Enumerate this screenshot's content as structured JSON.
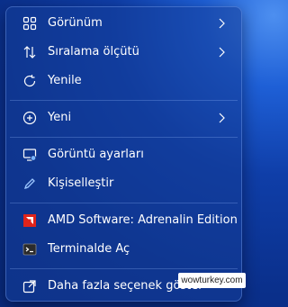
{
  "menu": {
    "items": [
      {
        "label": "Görünüm",
        "icon": "grid-icon",
        "submenu": true
      },
      {
        "label": "Sıralama ölçütü",
        "icon": "sort-arrows-icon",
        "submenu": true
      },
      {
        "label": "Yenile",
        "icon": "refresh-icon",
        "submenu": false
      },
      {
        "label": "Yeni",
        "icon": "plus-circle-icon",
        "submenu": true
      },
      {
        "label": "Görüntü ayarları",
        "icon": "display-settings-icon",
        "submenu": false
      },
      {
        "label": "Kişiselleştir",
        "icon": "pencil-icon",
        "submenu": false
      },
      {
        "label": "AMD Software: Adrenalin Edition",
        "icon": "amd-logo-icon",
        "submenu": false
      },
      {
        "label": "Terminalde Aç",
        "icon": "terminal-icon",
        "submenu": false
      },
      {
        "label": "Daha fazla seçenek göster",
        "icon": "share-icon",
        "submenu": false
      }
    ]
  },
  "watermark": {
    "text": "wowturkey.com"
  },
  "colors": {
    "text": "#ffffff",
    "amd_red": "#e0241b",
    "accent_blue": "#7ab4ff"
  }
}
